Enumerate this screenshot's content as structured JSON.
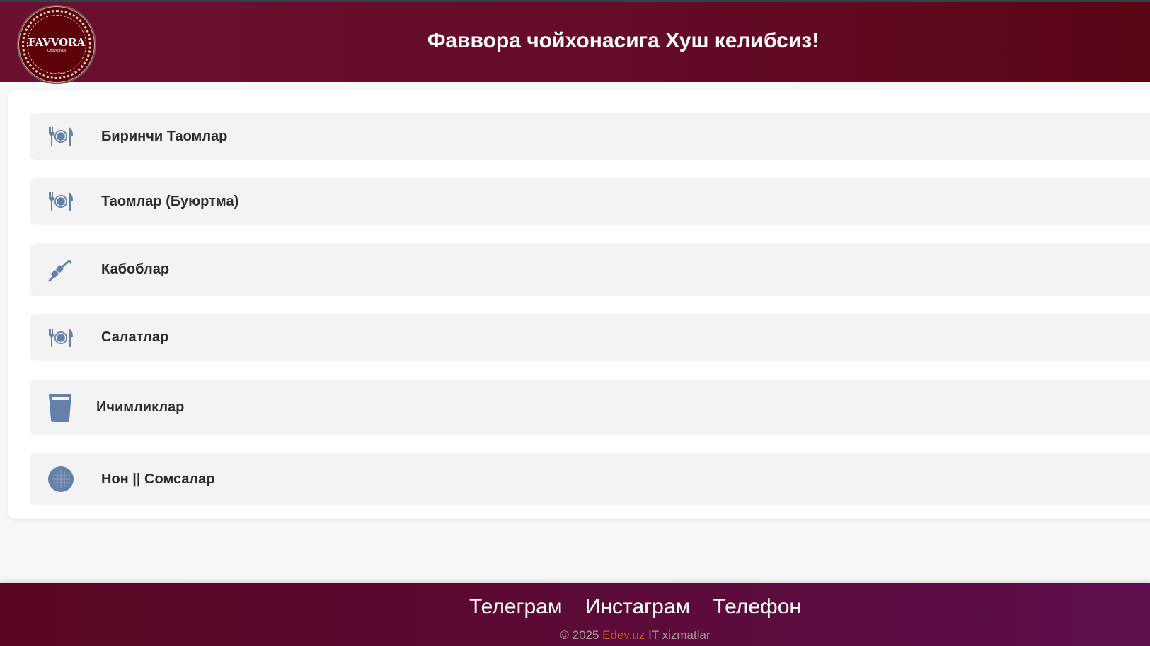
{
  "header": {
    "title": "Фаввора чойхонасига Хуш келибсиз!",
    "logo": {
      "name": "Favvora",
      "subtitle": "Choyxonasi",
      "since": "Since 2014"
    }
  },
  "menu": {
    "items": [
      {
        "label": "Биринчи Таомлар",
        "icon": "plate-utensils-icon"
      },
      {
        "label": "Таомлар (Буюртма)",
        "icon": "plate-utensils-icon"
      },
      {
        "label": "Кабоблар",
        "icon": "skewer-icon"
      },
      {
        "label": "Салатлар",
        "icon": "plate-utensils-icon"
      },
      {
        "label": "Ичимликлар",
        "icon": "glass-icon"
      },
      {
        "label": "Нон || Сомсалар",
        "icon": "bread-icon"
      }
    ]
  },
  "footer": {
    "links": [
      "Телеграм",
      "Инстаграм",
      "Телефон"
    ],
    "copyright": "© 2025",
    "company": "Edev.uz",
    "suffix": "IT xizmatlar"
  },
  "colors": {
    "icon": "#6580aa",
    "header": "#6b0f30",
    "footer": "#5c0b3a",
    "accent": "#c95a1e"
  }
}
